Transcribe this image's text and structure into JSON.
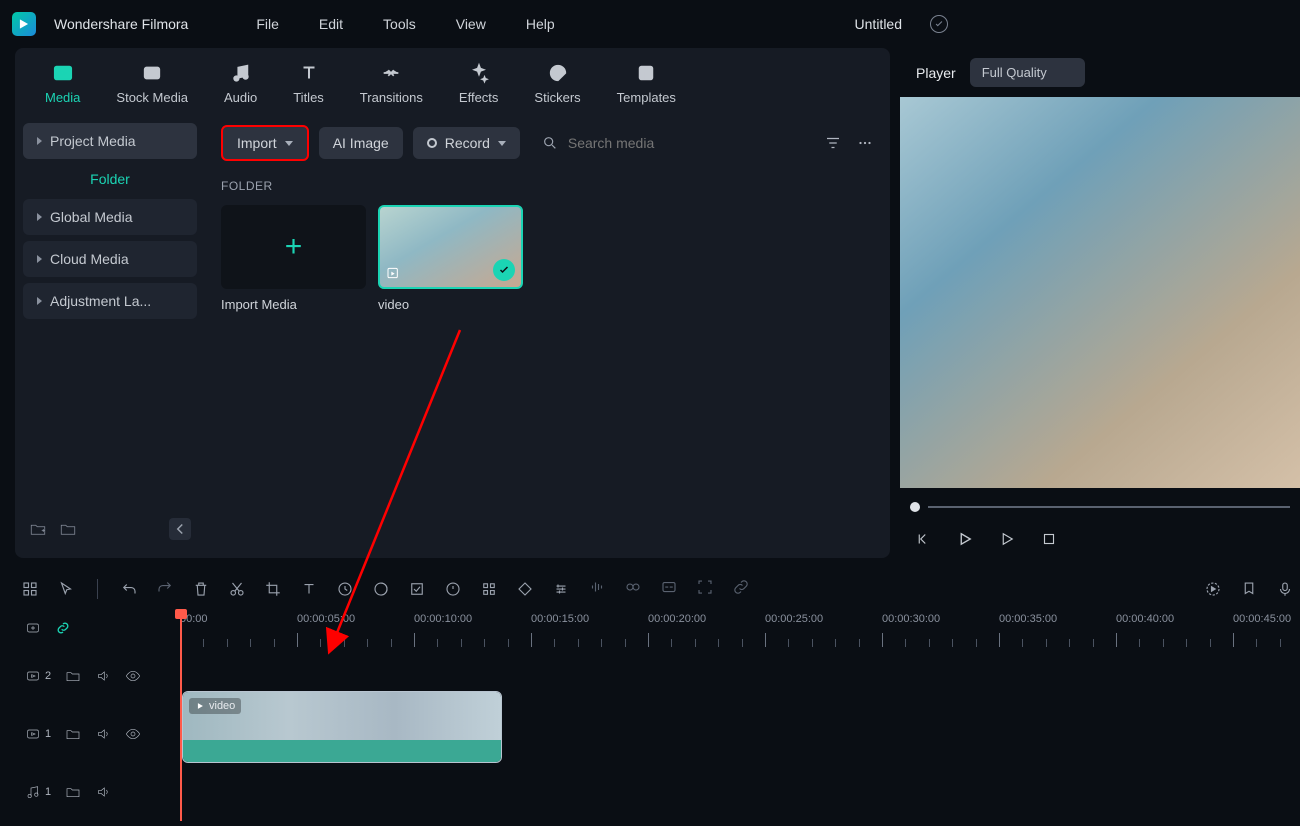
{
  "titlebar": {
    "app_name": "Wondershare Filmora",
    "menu": [
      "File",
      "Edit",
      "Tools",
      "View",
      "Help"
    ],
    "project_title": "Untitled"
  },
  "tabs": [
    {
      "label": "Media"
    },
    {
      "label": "Stock Media"
    },
    {
      "label": "Audio"
    },
    {
      "label": "Titles"
    },
    {
      "label": "Transitions"
    },
    {
      "label": "Effects"
    },
    {
      "label": "Stickers"
    },
    {
      "label": "Templates"
    }
  ],
  "sidebar": {
    "project_media": "Project Media",
    "folder": "Folder",
    "global_media": "Global Media",
    "cloud_media": "Cloud Media",
    "adjustment": "Adjustment La..."
  },
  "toolbar": {
    "import": "Import",
    "ai_image": "AI Image",
    "record": "Record",
    "search_placeholder": "Search media"
  },
  "media": {
    "folder_label": "FOLDER",
    "import_media": "Import Media",
    "video": "video"
  },
  "player": {
    "title": "Player",
    "quality": "Full Quality"
  },
  "timeline": {
    "ticks": [
      "00:00",
      "00:00:05:00",
      "00:00:10:00",
      "00:00:15:00",
      "00:00:20:00",
      "00:00:25:00",
      "00:00:30:00",
      "00:00:35:00",
      "00:00:40:00",
      "00:00:45:00"
    ],
    "track_v2": "2",
    "track_v1": "1",
    "track_a1": "1",
    "clip_label": "video"
  }
}
